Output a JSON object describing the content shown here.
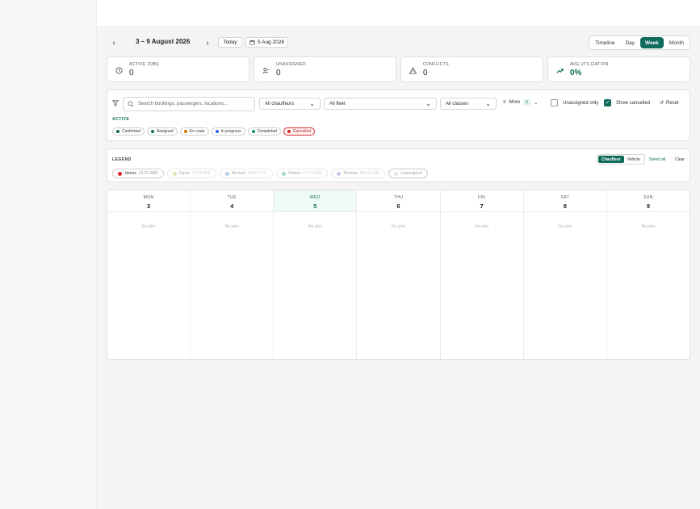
{
  "toolbar": {
    "prev_icon": "chevron-left-icon",
    "next_icon": "chevron-right-icon",
    "range_label": "3 – 9 August 2026",
    "today_label": "Today",
    "date_label": "5 Aug 2026",
    "views": [
      "Timeline",
      "Day",
      "Week",
      "Month"
    ],
    "active_view": "Week"
  },
  "stats": [
    {
      "label": "ACTIVE JOBS",
      "value": "0",
      "icon": "clock-icon"
    },
    {
      "label": "UNASSIGNED",
      "value": "0",
      "icon": "user-unassigned-icon"
    },
    {
      "label": "CONFLICTS",
      "value": "0",
      "icon": "warning-icon"
    },
    {
      "label": "AVG UTILIZATION",
      "value": "0%",
      "icon": "trend-up-icon"
    }
  ],
  "filters": {
    "search_placeholder": "Search bookings, passengers, locations...",
    "chauffeurs": "All chauffeurs",
    "fleet": "All fleet",
    "classes": "All classes",
    "more_label": "More",
    "more_count": "1",
    "unassigned_only": "Unassigned only",
    "show_cancelled": "Show cancelled",
    "reset": "Reset",
    "active_label": "ACTIVE",
    "statuses": [
      {
        "label": "Confirmed",
        "color": "#0f6b5c"
      },
      {
        "label": "Assigned",
        "color": "#0f6b5c"
      },
      {
        "label": "En route",
        "color": "#d97706"
      },
      {
        "label": "In progress",
        "color": "#2563eb"
      },
      {
        "label": "Completed",
        "color": "#059669"
      },
      {
        "label": "Cancelled",
        "color": "#dc2626"
      }
    ]
  },
  "legend": {
    "title": "LEGEND",
    "modes": [
      "Chauffeur",
      "Vehicle"
    ],
    "active_mode": "Chauffeur",
    "select_all": "Select all",
    "clear": "Clear",
    "items": [
      {
        "name": "James",
        "plate": "LK72 XMR",
        "color": "#dc2626"
      },
      {
        "name": "David",
        "plate": "LN71 BFS",
        "color": "#a3c75a"
      },
      {
        "name": "Michael",
        "plate": "MA72 VCL",
        "color": "#5b9bd5"
      },
      {
        "name": "Robert",
        "plate": "LR74 EXE",
        "color": "#34a887"
      },
      {
        "name": "Thomas",
        "plate": "MA73 SRK",
        "color": "#8b7fd9"
      },
      {
        "name": "Unassigned",
        "plate": "",
        "color": "#c8c8c4"
      }
    ]
  },
  "calendar": {
    "days": [
      {
        "dow": "MON",
        "num": "3"
      },
      {
        "dow": "TUE",
        "num": "4"
      },
      {
        "dow": "WED",
        "num": "5"
      },
      {
        "dow": "THU",
        "num": "6"
      },
      {
        "dow": "FRI",
        "num": "7"
      },
      {
        "dow": "SAT",
        "num": "8"
      },
      {
        "dow": "SUN",
        "num": "9"
      }
    ],
    "today": "5",
    "empty_text": "No jobs"
  }
}
